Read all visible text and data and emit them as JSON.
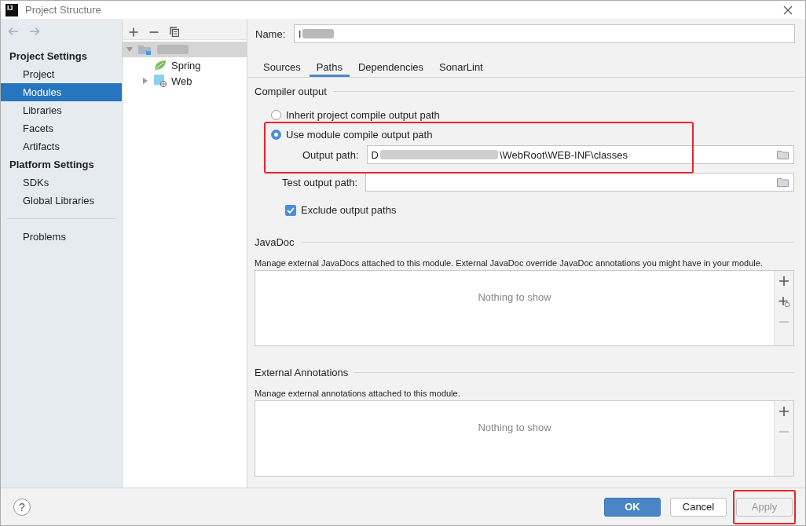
{
  "window": {
    "title": "Project Structure",
    "app_icon_text": "IJ"
  },
  "sidebar": {
    "sections": [
      {
        "title": "Project Settings",
        "items": [
          {
            "label": "Project",
            "selected": false
          },
          {
            "label": "Modules",
            "selected": true
          },
          {
            "label": "Libraries",
            "selected": false
          },
          {
            "label": "Facets",
            "selected": false
          },
          {
            "label": "Artifacts",
            "selected": false
          }
        ]
      },
      {
        "title": "Platform Settings",
        "items": [
          {
            "label": "SDKs",
            "selected": false
          },
          {
            "label": "Global Libraries",
            "selected": false
          }
        ]
      }
    ],
    "bottom_items": [
      {
        "label": "Problems",
        "selected": false
      }
    ]
  },
  "tree": {
    "nodes": [
      {
        "kind": "module",
        "redacted": true,
        "selected": true,
        "expanded": true,
        "children": [
          {
            "kind": "spring",
            "label": "Spring",
            "selected": false
          },
          {
            "kind": "web",
            "label": "Web",
            "selected": false,
            "expanded": false
          }
        ]
      }
    ]
  },
  "name_field": {
    "label": "Name:",
    "value": "l",
    "redacted": true
  },
  "tabs": [
    {
      "label": "Sources",
      "selected": false
    },
    {
      "label": "Paths",
      "selected": true
    },
    {
      "label": "Dependencies",
      "selected": false
    },
    {
      "label": "SonarLint",
      "selected": false
    }
  ],
  "compiler_output": {
    "title": "Compiler output",
    "options": [
      {
        "label": "Inherit project compile output path",
        "selected": false,
        "highlighted": false
      },
      {
        "label": "Use module compile output path",
        "selected": true,
        "highlighted": true
      }
    ],
    "output_path": {
      "label": "Output path:",
      "value_start": "D",
      "value_end": "\\WebRoot\\WEB-INF\\classes",
      "redacted": true
    },
    "test_output_path": {
      "label": "Test output path:"
    },
    "exclude": {
      "label": "Exclude output paths",
      "checked": true
    }
  },
  "panels": [
    {
      "title": "JavaDoc",
      "description": "Manage external JavaDocs attached to this module. External JavaDoc override JavaDoc annotations you might have in your module.",
      "empty_text": "Nothing to show",
      "tools": [
        {
          "kind": "add",
          "disabled": false
        },
        {
          "kind": "add-url",
          "disabled": false
        },
        {
          "kind": "remove",
          "disabled": true
        }
      ]
    },
    {
      "title": "External Annotations",
      "description": "Manage external annotations attached to this module.",
      "empty_text": "Nothing to show",
      "tools": [
        {
          "kind": "add",
          "disabled": false
        },
        {
          "kind": "remove",
          "disabled": true
        }
      ]
    }
  ],
  "footer": {
    "help": "?",
    "buttons": [
      {
        "label": "OK",
        "kind": "primary",
        "disabled": false,
        "highlighted": false
      },
      {
        "label": "Cancel",
        "kind": "normal",
        "disabled": false,
        "highlighted": false
      },
      {
        "label": "Apply",
        "kind": "normal",
        "disabled": true,
        "highlighted": true
      }
    ]
  }
}
